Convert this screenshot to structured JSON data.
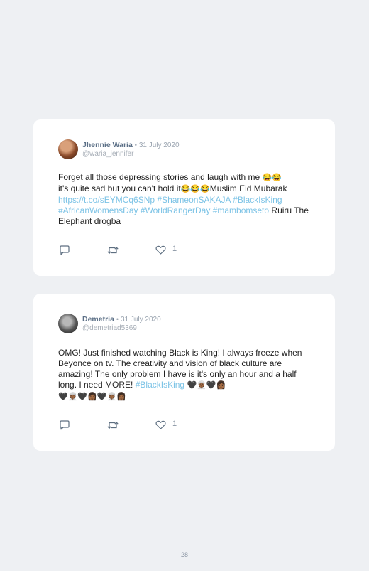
{
  "tweets": [
    {
      "name": "Jhennie Waria",
      "separator": "•",
      "date": "31 July 2020",
      "handle": "@waria_jennifer",
      "text_1": "Forget all those depressing stories and laugh with me ",
      "emoji_1": "😂😂",
      "text_2": "it's quite sad but you can't hold it",
      "emoji_2": "😂😂😂",
      "text_3": "Muslim Eid Mubarak ",
      "link_1": "https://t.co/sEYMCq6SNp",
      "hashtag_1": "#ShameonSAKAJA",
      "hashtag_2": "#BlackIsKing",
      "hashtag_3": "#AfricanWomensDay",
      "hashtag_4": "#WorldRangerDay",
      "hashtag_5": "#mambomseto",
      "text_4": " Ruiru The Elephant drogba",
      "like_count": "1"
    },
    {
      "name": "Demetria",
      "separator": "•",
      "date": "31 July 2020",
      "handle": "@demetriad5369",
      "text_1": "OMG! Just finished watching Black is King! I always freeze when Beyonce on tv. The creativity and vision of black culture are amazing! The only problem I have is it's only an hour and a half long. I need MORE! ",
      "hashtag_1": "#BlackIsKing",
      "emoji_1": "🖤👳🏾🖤👩🏾",
      "emoji_2": "🖤👳🏾🖤👩🏾🖤👳🏾👩🏾",
      "like_count": "1"
    }
  ],
  "page_number": "28",
  "icons": [
    "reply-icon",
    "retweet-icon",
    "like-icon"
  ]
}
